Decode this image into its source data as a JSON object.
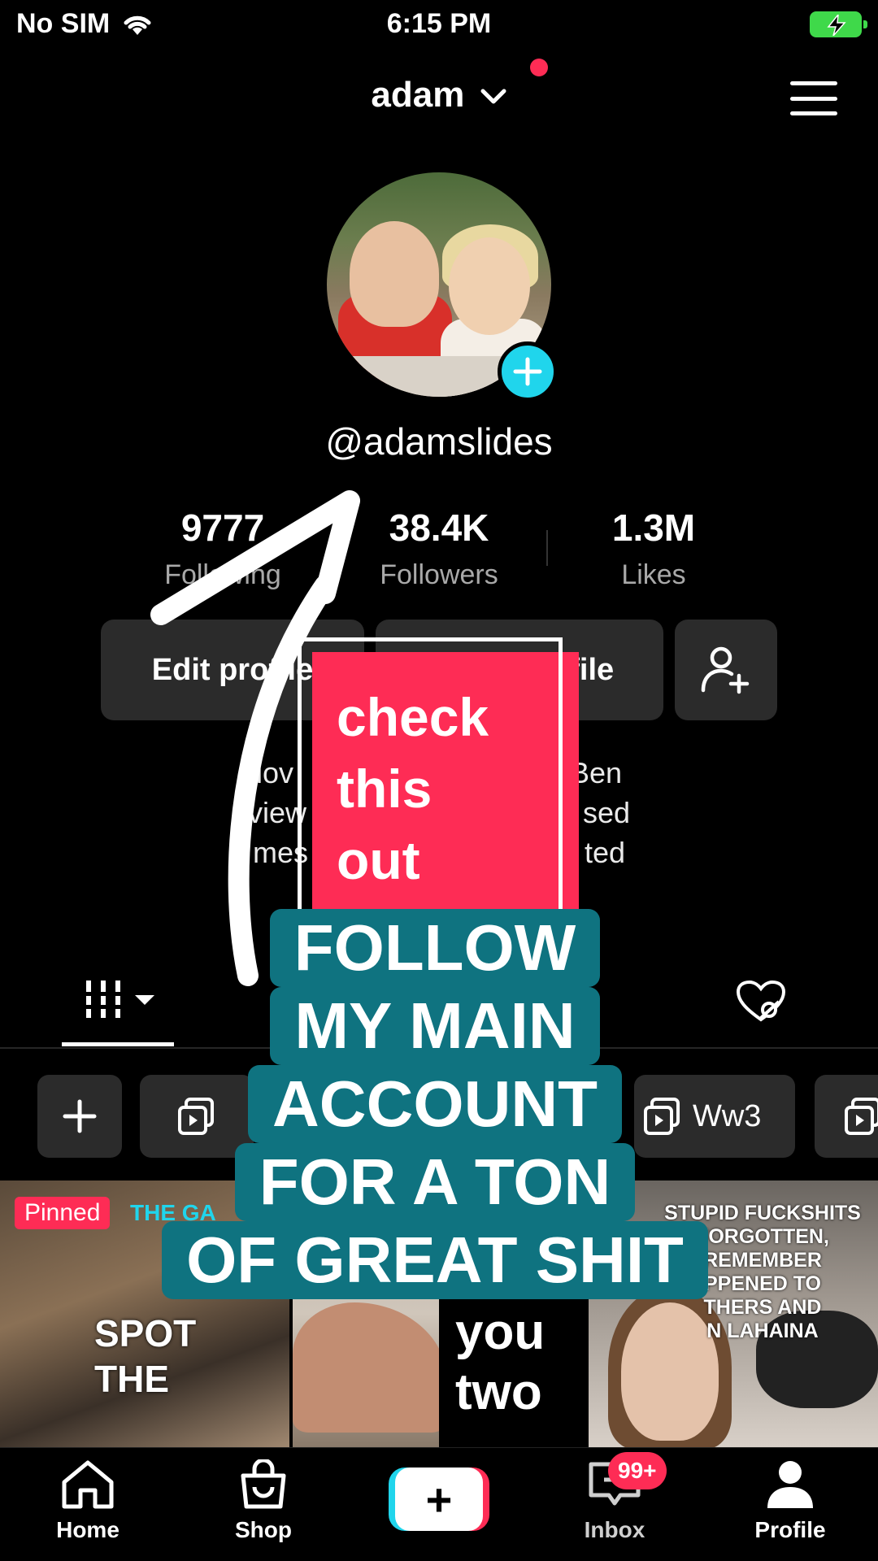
{
  "status_bar": {
    "carrier": "No SIM",
    "time": "6:15 PM"
  },
  "header": {
    "username": "adam"
  },
  "profile": {
    "handle": "@adamslides"
  },
  "stats": [
    {
      "value": "9777",
      "label": "Following"
    },
    {
      "value": "38.4K",
      "label": "Followers"
    },
    {
      "value": "1.3M",
      "label": "Likes"
    }
  ],
  "buttons": {
    "edit_profile": "Edit profile",
    "share_profile": "Share profile"
  },
  "bio": [
    "lov",
    "Ben",
    "view",
    "sed",
    "mes",
    "ted"
  ],
  "playlists": [
    {
      "label": "Ww3"
    }
  ],
  "videos": {
    "pinned_badge": "Pinned",
    "v1_title": "THE GA",
    "v1_overlay_line1": "SPOT",
    "v1_overlay_line2": "THE",
    "v2_overlay_line1": "you",
    "v2_overlay_line2": "two",
    "v3_news_lines": [
      "STUPID FUCKSHITS",
      "FORGOTTEN,",
      "REMEMBER",
      "PPENED TO",
      "THERS AND",
      "N LAHAINA"
    ]
  },
  "stickers": {
    "check_lines": [
      "check",
      "this",
      "out"
    ],
    "follow_lines": [
      "FOLLOW",
      "MY MAIN",
      "ACCOUNT",
      "FOR A TON",
      "OF GREAT SHIT"
    ]
  },
  "bottom_nav": {
    "home": "Home",
    "shop": "Shop",
    "inbox": "Inbox",
    "inbox_badge": "99+",
    "profile": "Profile"
  },
  "colors": {
    "accent_pink": "#fe2c55",
    "accent_cyan": "#20d5ec",
    "sticker_teal": "#0f7380",
    "battery": "#3fd94a"
  }
}
